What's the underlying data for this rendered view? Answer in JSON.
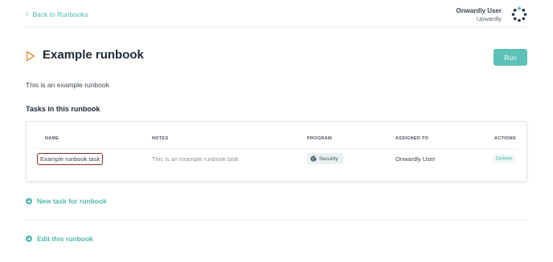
{
  "nav": {
    "back_label": "Back to Runbooks"
  },
  "user": {
    "name": "Onwardly User",
    "org": "Upwardly"
  },
  "runbook": {
    "title": "Example runbook",
    "run_label": "Run",
    "description": "This is an example runbook"
  },
  "tasks_section": {
    "title": "Tasks in this runbook",
    "columns": [
      "NAME",
      "NOTES",
      "PROGRAM",
      "ASSIGNED TO",
      "ACTIONS"
    ],
    "rows": [
      {
        "name": "Example runbook task",
        "notes": "This is an example runbook task",
        "program": "Security",
        "assigned_to": "Onwardly User",
        "action": "Delete"
      }
    ]
  },
  "actions": {
    "new_task_label": "New task for runbook",
    "edit_label": "Edit this runbook"
  },
  "colors": {
    "accent": "#5cc1b6",
    "link": "#4fb8b0",
    "play_icon": "#d9923a",
    "highlight_border": "#8c2b2b"
  }
}
